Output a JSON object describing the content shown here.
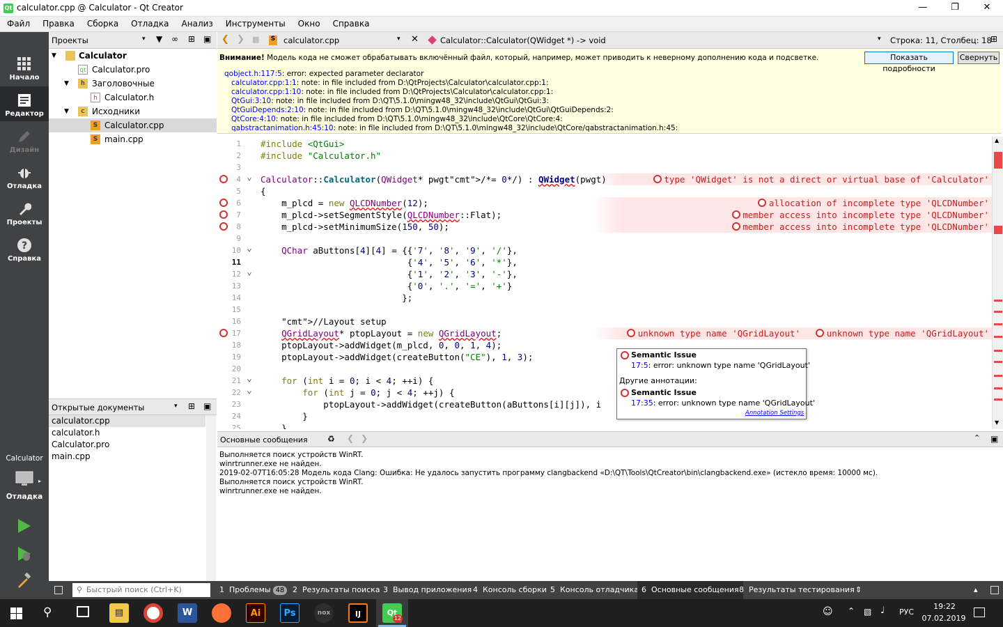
{
  "window": {
    "title": "calculator.cpp @ Calculator - Qt Creator"
  },
  "menu": [
    "Файл",
    "Правка",
    "Сборка",
    "Отладка",
    "Анализ",
    "Инструменты",
    "Окно",
    "Справка"
  ],
  "modes": [
    {
      "label": "Начало",
      "icon": "grid-icon"
    },
    {
      "label": "Редактор",
      "icon": "editor-icon"
    },
    {
      "label": "Дизайн",
      "icon": "pen-icon"
    },
    {
      "label": "Отладка",
      "icon": "bug-icon"
    },
    {
      "label": "Проекты",
      "icon": "wrench-icon"
    },
    {
      "label": "Справка",
      "icon": "help-icon"
    }
  ],
  "target": {
    "project": "Calculator",
    "mode": "Отладка"
  },
  "projects": {
    "header": "Проекты",
    "tree": [
      {
        "label": "Calculator",
        "depth": 0,
        "bold": true,
        "expanded": true
      },
      {
        "label": "Calculator.pro",
        "depth": 1
      },
      {
        "label": "Заголовочные",
        "depth": 1,
        "expanded": true
      },
      {
        "label": "Calculator.h",
        "depth": 2
      },
      {
        "label": "Исходники",
        "depth": 1,
        "expanded": true
      },
      {
        "label": "Calculator.cpp",
        "depth": 2,
        "selected": true
      },
      {
        "label": "main.cpp",
        "depth": 2
      }
    ]
  },
  "open_docs": {
    "header": "Открытые документы",
    "items": [
      "calculator.cpp",
      "calculator.h",
      "Calculator.pro",
      "main.cpp"
    ]
  },
  "editor": {
    "file": "calculator.cpp",
    "symbol": "Calculator::Calculator(QWidget *) -> void",
    "cursor": "Строка: 11, Столбец: 18"
  },
  "warning": {
    "bold": "Внимание!",
    "text": "Модель кода не сможет обрабатывать включённый файл, который, например, может приводить к неверному дополнению кода и подсветке.",
    "details_button": "Показать подробности",
    "collapse_button": "Свернуть",
    "lines": [
      {
        "link": "qobject.h:117:5",
        "text": ": error: expected parameter declarator",
        "indent": false
      },
      {
        "link": "calculator.cpp:1:1",
        "text": ": note: in file included from D:\\QtProjects\\Calculator\\calculator.cpp:1:",
        "indent": true
      },
      {
        "link": "calculator.cpp:1:10",
        "text": ": note: in file included from D:\\QtProjects\\Calculator\\calculator.cpp:1:",
        "indent": true
      },
      {
        "link": "QtGui:3:10",
        "text": ": note: in file included from D:\\QT\\5.1.0\\mingw48_32\\include\\QtGui\\QtGui:3:",
        "indent": true
      },
      {
        "link": "QtGuiDepends:2:10",
        "text": ": note: in file included from D:\\QT\\5.1.0\\mingw48_32\\include\\QtGui\\QtGuiDepends:2:",
        "indent": true
      },
      {
        "link": "QtCore:4:10",
        "text": ": note: in file included from D:\\QT\\5.1.0\\mingw48_32\\include\\QtCore\\QtCore:4:",
        "indent": true
      },
      {
        "link": "qabstractanimation.h:45:10",
        "text": ": note: in file included from D:\\QT\\5.1.0\\mingw48_32\\include\\QtCore/qabstractanimation.h:45:",
        "indent": true
      }
    ]
  },
  "code": {
    "lines": [
      {
        "n": "1",
        "t": "#include <QtGui>"
      },
      {
        "n": "2",
        "t": "#include \"Calculator.h\""
      },
      {
        "n": "3",
        "t": ""
      },
      {
        "n": "4",
        "t": "Calculator::Calculator(QWidget* pwgt/*= 0*/) : QWidget(pwgt)",
        "err": true,
        "fold": true
      },
      {
        "n": "5",
        "t": "{"
      },
      {
        "n": "6",
        "t": "    m_plcd = new QLCDNumber(12);",
        "err": true
      },
      {
        "n": "7",
        "t": "    m_plcd->setSegmentStyle(QLCDNumber::Flat);",
        "err": true
      },
      {
        "n": "8",
        "t": "    m_plcd->setMinimumSize(150, 50);",
        "err": true
      },
      {
        "n": "9",
        "t": ""
      },
      {
        "n": "10",
        "t": "    QChar aButtons[4][4] = {{'7', '8', '9', '/'},",
        "fold": true
      },
      {
        "n": "11",
        "t": "                            {'4', '5', '6', '*'},",
        "cur": true
      },
      {
        "n": "12",
        "t": "                            {'1', '2', '3', '-'},",
        "fold": true
      },
      {
        "n": "13",
        "t": "                            {'0', '.', '=', '+'}"
      },
      {
        "n": "14",
        "t": "                           };"
      },
      {
        "n": "15",
        "t": ""
      },
      {
        "n": "16",
        "t": "    //Layout setup"
      },
      {
        "n": "17",
        "t": "    QGridLayout* ptopLayout = new QGridLayout;",
        "err": true
      },
      {
        "n": "18",
        "t": "    ptopLayout->addWidget(m_plcd, 0, 0, 1, 4);"
      },
      {
        "n": "19",
        "t": "    ptopLayout->addWidget(createButton(\"CE\"), 1, 3);"
      },
      {
        "n": "20",
        "t": ""
      },
      {
        "n": "21",
        "t": "    for (int i = 0; i < 4; ++i) {",
        "fold": true
      },
      {
        "n": "22",
        "t": "        for (int j = 0; j < 4; ++j) {",
        "fold": true
      },
      {
        "n": "23",
        "t": "            ptopLayout->addWidget(createButton(aButtons[i][j]), i"
      },
      {
        "n": "24",
        "t": "        }"
      },
      {
        "n": "25",
        "t": "    }"
      }
    ],
    "annotations": [
      {
        "line": 4,
        "text": "type 'QWidget' is not a direct or virtual base of 'Calculator'"
      },
      {
        "line": 6,
        "text": "allocation of incomplete type 'QLCDNumber'"
      },
      {
        "line": 7,
        "text": "member access into incomplete type 'QLCDNumber'"
      },
      {
        "line": 8,
        "text": "member access into incomplete type 'QLCDNumber'"
      },
      {
        "line": 17,
        "text": "unknown type name 'QGridLayout'",
        "text2": "unknown type name 'QGridLayout'"
      }
    ]
  },
  "tooltip": {
    "title1": "Semantic Issue",
    "loc1": "17:5",
    "msg1": ": error: unknown type name 'QGridLayout'",
    "other": "Другие аннотации:",
    "title2": "Semantic Issue",
    "loc2": "17:35",
    "msg2": ": error: unknown type name 'QGridLayout'",
    "settings": "Annotation Settings"
  },
  "output": {
    "header": "Основные сообщения",
    "lines": [
      "Выполняется поиск устройств WinRT.",
      "winrtrunner.exe не найден.",
      "2019-02-07T16:05:28 Модель кода Clang: Ошибка: Не удалось запустить программу clangbackend «D:\\QT\\Tools\\QtCreator\\bin\\clangbackend.exe» (истекло время: 10000 мс).",
      "Выполняется поиск устройств WinRT.",
      "winrtrunner.exe не найден."
    ]
  },
  "statusbar": {
    "search_placeholder": "Быстрый поиск (Ctrl+K)",
    "tabs": [
      {
        "num": "1",
        "label": "Проблемы",
        "badge": "48"
      },
      {
        "num": "2",
        "label": "Результаты поиска"
      },
      {
        "num": "3",
        "label": "Вывод приложения"
      },
      {
        "num": "4",
        "label": "Консоль сборки"
      },
      {
        "num": "5",
        "label": "Консоль отладчика"
      },
      {
        "num": "6",
        "label": "Основные сообщения",
        "active": true
      },
      {
        "num": "8",
        "label": "Результаты тестирования"
      }
    ]
  },
  "taskbar": {
    "lang": "РУС",
    "time": "19:22",
    "date": "07.02.2019",
    "qt_badge": "12"
  },
  "colors": {
    "modebar": "#404244",
    "warning_bg": "#ffffe1",
    "error": "#d23232",
    "keyword": "#808000",
    "string": "#008000"
  }
}
